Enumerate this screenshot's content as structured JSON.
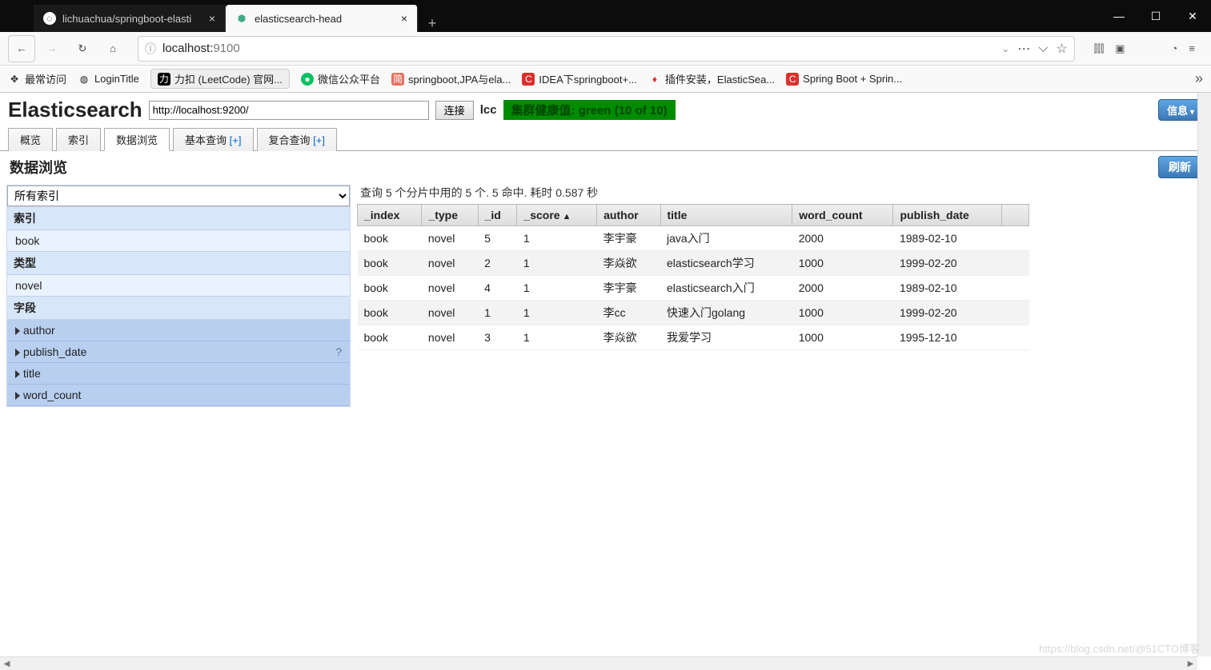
{
  "browser": {
    "tabs": [
      {
        "title": "lichuachua/springboot-elasti",
        "active": false,
        "icon": "github"
      },
      {
        "title": "elasticsearch-head",
        "active": true,
        "icon": "eshead"
      }
    ],
    "url_display_host": "localhost:",
    "url_display_port": "9100",
    "bookmarks": [
      {
        "label": "最常访问",
        "icon": "✦"
      },
      {
        "label": "LoginTitle",
        "icon": "◍"
      },
      {
        "label": "力扣 (LeetCode) 官网...",
        "icon": "力"
      },
      {
        "label": "微信公众平台",
        "icon": "wx"
      },
      {
        "label": "springboot,JPA与ela...",
        "icon": "简"
      },
      {
        "label": "IDEA下springboot+...",
        "icon": "C"
      },
      {
        "label": "插件安装，ElasticSea...",
        "icon": "🔥"
      },
      {
        "label": "Spring Boot + Sprin...",
        "icon": "C"
      }
    ]
  },
  "es": {
    "logo": "Elasticsearch",
    "conn_url": "http://localhost:9200/",
    "connect_btn": "连接",
    "cluster_name": "lcc",
    "health": "集群健康值: green (10 of 10)",
    "info_btn": "信息",
    "refresh_btn": "刷新",
    "tabs": [
      {
        "label": "概览",
        "active": false
      },
      {
        "label": "索引",
        "active": false
      },
      {
        "label": "数据浏览",
        "active": true
      },
      {
        "label": "基本查询 [+]",
        "active": false
      },
      {
        "label": "复合查询 [+]",
        "active": false
      }
    ],
    "page_title": "数据浏览",
    "sidebar": {
      "select_value": "所有索引",
      "sections": [
        {
          "header": "索引",
          "items": [
            {
              "label": "book",
              "style": "pale"
            }
          ]
        },
        {
          "header": "类型",
          "items": [
            {
              "label": "novel",
              "style": "pale"
            }
          ]
        },
        {
          "header": "字段",
          "items": [
            {
              "label": "author",
              "style": "blue",
              "arrow": true
            },
            {
              "label": "publish_date",
              "style": "blue",
              "arrow": true,
              "q": "?"
            },
            {
              "label": "title",
              "style": "blue",
              "arrow": true
            },
            {
              "label": "word_count",
              "style": "blue",
              "arrow": true
            }
          ]
        }
      ]
    },
    "query_info": "查询 5 个分片中用的 5 个. 5 命中. 耗时 0.587 秒",
    "columns": [
      "_index",
      "_type",
      "_id",
      "_score",
      "author",
      "title",
      "word_count",
      "publish_date"
    ],
    "sorted_col": "_score",
    "rows": [
      {
        "_index": "book",
        "_type": "novel",
        "_id": "5",
        "_score": "1",
        "author": "李宇豪",
        "title": "java入门",
        "word_count": "2000",
        "publish_date": "1989-02-10"
      },
      {
        "_index": "book",
        "_type": "novel",
        "_id": "2",
        "_score": "1",
        "author": "李焱欲",
        "title": "elasticsearch学习",
        "word_count": "1000",
        "publish_date": "1999-02-20"
      },
      {
        "_index": "book",
        "_type": "novel",
        "_id": "4",
        "_score": "1",
        "author": "李宇豪",
        "title": "elasticsearch入门",
        "word_count": "2000",
        "publish_date": "1989-02-10"
      },
      {
        "_index": "book",
        "_type": "novel",
        "_id": "1",
        "_score": "1",
        "author": "李cc",
        "title": "快速入门golang",
        "word_count": "1000",
        "publish_date": "1999-02-20"
      },
      {
        "_index": "book",
        "_type": "novel",
        "_id": "3",
        "_score": "1",
        "author": "李焱欲",
        "title": "我爱学习",
        "word_count": "1000",
        "publish_date": "1995-12-10"
      }
    ]
  },
  "watermark": "https://blog.csdn.net/@51CTO博客"
}
